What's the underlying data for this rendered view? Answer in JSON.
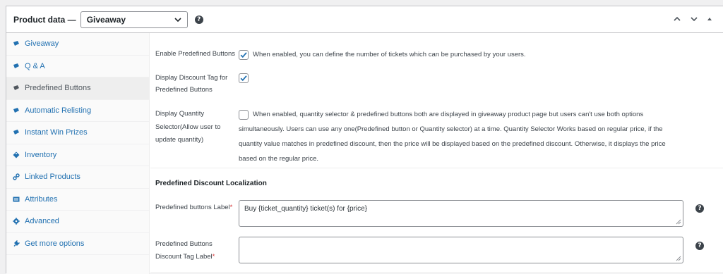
{
  "header": {
    "title": "Product data —",
    "product_type": "Giveaway",
    "help_icon": "question-circle-icon",
    "controls": [
      "chevron-up-icon",
      "chevron-down-icon",
      "caret-up-icon"
    ]
  },
  "sidebar": {
    "items": [
      {
        "label": "Giveaway",
        "icon": "ticket-icon",
        "active": false
      },
      {
        "label": "Q & A",
        "icon": "ticket-icon",
        "active": false
      },
      {
        "label": "Predefined Buttons",
        "icon": "ticket-icon",
        "active": true
      },
      {
        "label": "Automatic Relisting",
        "icon": "ticket-icon",
        "active": false
      },
      {
        "label": "Instant Win Prizes",
        "icon": "ticket-icon",
        "active": false
      },
      {
        "label": "Inventory",
        "icon": "tag-icon",
        "active": false
      },
      {
        "label": "Linked Products",
        "icon": "link-icon",
        "active": false
      },
      {
        "label": "Attributes",
        "icon": "list-icon",
        "active": false
      },
      {
        "label": "Advanced",
        "icon": "gear-icon",
        "active": false
      },
      {
        "label": "Get more options",
        "icon": "plugin-icon",
        "active": false
      }
    ]
  },
  "fields": {
    "enable_predefined": {
      "label": "Enable Predefined Buttons",
      "checked": true,
      "description": "When enabled, you can define the number of tickets which can be purchased by your users."
    },
    "discount_tag": {
      "label_line1": "Display Discount Tag for",
      "label_line2": "Predefined Buttons",
      "checked": true
    },
    "quantity_selector": {
      "label_line1": "Display Quantity",
      "label_line2": "Selector(Allow user to",
      "label_line3": "update quantity)",
      "checked": false,
      "desc_line1": "When enabled, quantity selector & predefined buttons both are displayed in giveaway product page but users can't use both options",
      "desc_line2": "simultaneously. Users can use any one(Predefined button or Quantity selector) at a time. Quantity Selector Works based on regular price, if the",
      "desc_line3": "quantity value matches in predefined discount, then the price will be displayed based on the predefined discount. Otherwise, it displays the price",
      "desc_line4": "based on the regular price."
    }
  },
  "localization": {
    "section_title": "Predefined Discount Localization",
    "buttons_label": {
      "label": "Predefined buttons Label",
      "required_mark": "*",
      "value": "Buy {ticket_quantity} ticket(s) for {price}"
    },
    "discount_tag_label": {
      "label_line1": "Predefined Buttons",
      "label_line2": "Discount Tag Label",
      "required_mark": "*",
      "value": ""
    }
  },
  "colors": {
    "link": "#2271b1",
    "checkbox_check": "#2271b1",
    "required": "#d63638"
  }
}
